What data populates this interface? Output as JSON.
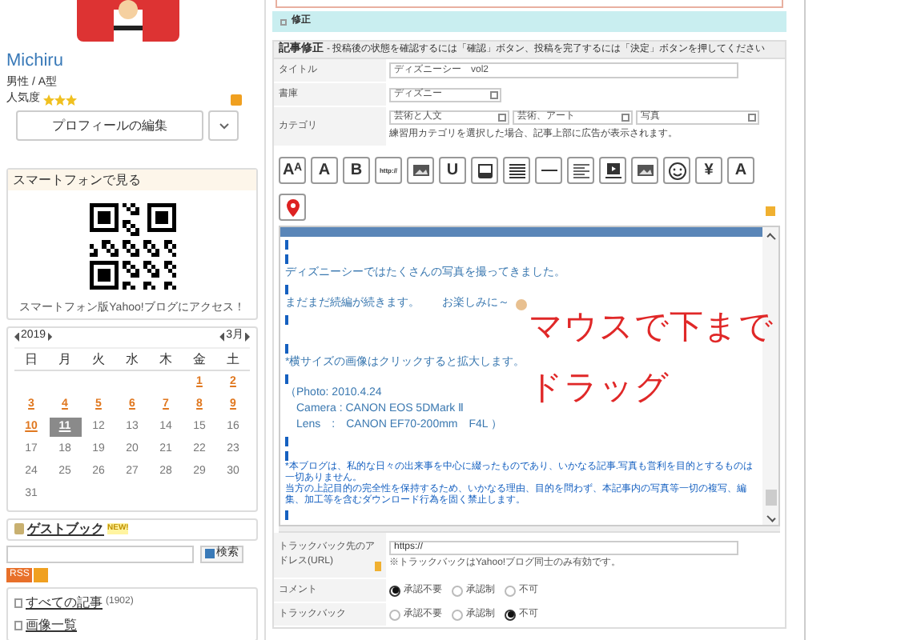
{
  "profile": {
    "name": "Michiru",
    "info": "男性 / A型",
    "popularity_label": "人気度",
    "stars": 3,
    "edit_button": "プロフィールの編集"
  },
  "smartphone": {
    "title": "スマートフォンで見る",
    "caption": "スマートフォン版Yahoo!ブログにアクセス！"
  },
  "calendar": {
    "year": "2019",
    "month": "3月",
    "weekdays": [
      "日",
      "月",
      "火",
      "水",
      "木",
      "金",
      "土"
    ],
    "weeks": [
      {
        "kind": "trailing",
        "days": [
          {
            "day": "1",
            "linked": true,
            "selected": false
          },
          {
            "day": "2",
            "linked": true,
            "selected": false
          }
        ]
      },
      {
        "kind": "leading",
        "days": [
          {
            "day": "3",
            "linked": true,
            "selected": false
          },
          {
            "day": "4",
            "linked": true,
            "selected": false
          },
          {
            "day": "5",
            "linked": true,
            "selected": false
          },
          {
            "day": "6",
            "linked": true,
            "selected": false
          },
          {
            "day": "7",
            "linked": true,
            "selected": false
          },
          {
            "day": "8",
            "linked": true,
            "selected": false
          },
          {
            "day": "9",
            "linked": true,
            "selected": false
          }
        ]
      },
      {
        "kind": "leading",
        "days": [
          {
            "day": "10",
            "linked": true,
            "selected": false
          },
          {
            "day": "11",
            "linked": true,
            "selected": true
          },
          {
            "day": "12",
            "linked": false,
            "selected": false
          },
          {
            "day": "13",
            "linked": false,
            "selected": false
          },
          {
            "day": "14",
            "linked": false,
            "selected": false
          },
          {
            "day": "15",
            "linked": false,
            "selected": false
          },
          {
            "day": "16",
            "linked": false,
            "selected": false
          }
        ]
      },
      {
        "kind": "leading",
        "days": [
          {
            "day": "17",
            "linked": false,
            "selected": false
          },
          {
            "day": "18",
            "linked": false,
            "selected": false
          },
          {
            "day": "19",
            "linked": false,
            "selected": false
          },
          {
            "day": "20",
            "linked": false,
            "selected": false
          },
          {
            "day": "21",
            "linked": false,
            "selected": false
          },
          {
            "day": "22",
            "linked": false,
            "selected": false
          },
          {
            "day": "23",
            "linked": false,
            "selected": false
          }
        ]
      },
      {
        "kind": "leading",
        "days": [
          {
            "day": "24",
            "linked": false,
            "selected": false
          },
          {
            "day": "25",
            "linked": false,
            "selected": false
          },
          {
            "day": "26",
            "linked": false,
            "selected": false
          },
          {
            "day": "27",
            "linked": false,
            "selected": false
          },
          {
            "day": "28",
            "linked": false,
            "selected": false
          },
          {
            "day": "29",
            "linked": false,
            "selected": false
          },
          {
            "day": "30",
            "linked": false,
            "selected": false
          }
        ]
      },
      {
        "kind": "leading",
        "days": [
          {
            "day": "31",
            "linked": false,
            "selected": false
          }
        ]
      }
    ]
  },
  "guestbook": {
    "label": "ゲストブック",
    "badge": "NEW!"
  },
  "search": {
    "button": "検索"
  },
  "rss": {
    "label": "RSS"
  },
  "links": [
    {
      "label": "すべての記事",
      "count": "(1902)"
    },
    {
      "label": "画像一覧"
    }
  ],
  "section_bar": {
    "label": "修正"
  },
  "editor": {
    "title": "記事修正",
    "instruction": "- 投稿後の状態を確認するには「確認」ボタン、投稿を完了するには「決定」ボタンを押してください",
    "fields": [
      {
        "kind": "text",
        "label": "タイトル",
        "value": "ディズニーシー　vol2"
      },
      {
        "kind": "select",
        "label": "書庫",
        "values": [
          "ディズニー"
        ]
      },
      {
        "kind": "select",
        "label": "カテゴリ",
        "values": [
          "芸術と人文",
          "芸術、アート",
          "写真"
        ],
        "note": "練習用カテゴリを選択した場合、記事上部に広告が表示されます。"
      }
    ],
    "toolbar": [
      {
        "kind": "text",
        "label": "Aᴬ"
      },
      {
        "kind": "text",
        "label": "A"
      },
      {
        "kind": "text",
        "label": "B"
      },
      {
        "kind": "text",
        "label": "http://"
      },
      {
        "kind": "picture"
      },
      {
        "kind": "text",
        "label": "U"
      },
      {
        "kind": "bucket"
      },
      {
        "kind": "lines"
      },
      {
        "kind": "rule"
      },
      {
        "kind": "align"
      },
      {
        "kind": "video"
      },
      {
        "kind": "picture"
      },
      {
        "kind": "smiley"
      },
      {
        "kind": "text",
        "label": "¥"
      },
      {
        "kind": "text",
        "label": "A"
      },
      {
        "kind": "pin"
      }
    ],
    "content": [
      {
        "kind": "blank"
      },
      {
        "kind": "blank"
      },
      {
        "kind": "text",
        "text": "ディズニーシーではたくさんの写真を撮ってきました。"
      },
      {
        "kind": "blank"
      },
      {
        "kind": "text",
        "text": "まだまだ続編が続きます。　　お楽しみに～",
        "emoji": true
      },
      {
        "kind": "blank"
      },
      {
        "kind": "empty"
      },
      {
        "kind": "blank"
      },
      {
        "kind": "text",
        "text": "*横サイズの画像はクリックすると拡大します。"
      },
      {
        "kind": "blank"
      },
      {
        "kind": "text",
        "text": "（Photo: 2010.4.24"
      },
      {
        "kind": "text",
        "text": "　Camera : CANON EOS 5DMark Ⅱ"
      },
      {
        "kind": "text",
        "text": "　Lens　:　CANON EF70-200mm　F4L ）"
      },
      {
        "kind": "blank"
      },
      {
        "kind": "blank"
      },
      {
        "kind": "small",
        "text": "*本ブログは、私的な日々の出来事を中心に綴ったものであり、いかなる記事.写真も営利を目的とするものは一切ありません。"
      },
      {
        "kind": "small",
        "text": "当方の上記目的の完全性を保持するため、いかなる理由、目的を問わず、本記事内の写真等一切の複写、編集、加工等を含むダウンロード行為を固く禁止します。"
      },
      {
        "kind": "blank"
      }
    ],
    "annotation": [
      "マウスで下まで",
      "ドラッグ"
    ],
    "trackback": {
      "label": "トラックバック先のアドレス(URL)",
      "value": "https://",
      "note": "※トラックバックはYahoo!ブログ同士のみ有効です。"
    },
    "radio_rows": [
      {
        "label": "コメント",
        "options": [
          {
            "label": "承認不要",
            "selected": true
          },
          {
            "label": "承認制",
            "selected": false
          },
          {
            "label": "不可",
            "selected": false
          }
        ]
      },
      {
        "label": "トラックバック",
        "options": [
          {
            "label": "承認不要",
            "selected": false
          },
          {
            "label": "承認制",
            "selected": false
          },
          {
            "label": "不可",
            "selected": true
          }
        ]
      }
    ]
  }
}
